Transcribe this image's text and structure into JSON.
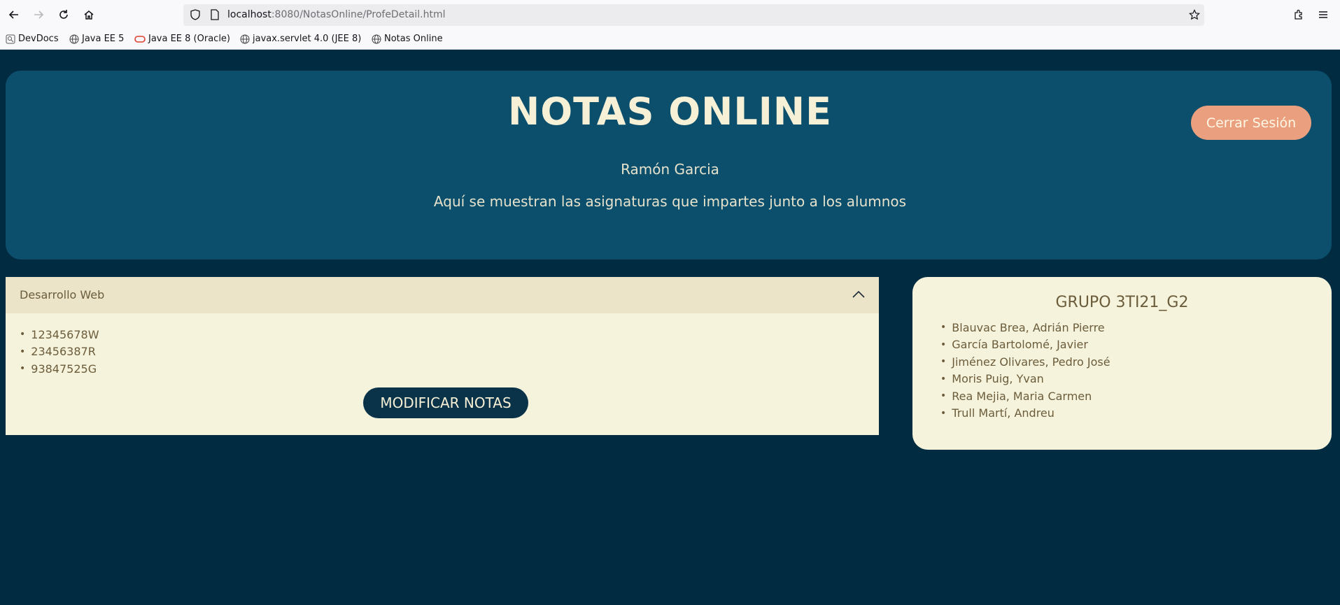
{
  "browser": {
    "url_host": "localhost",
    "url_rest": ":8080/NotasOnline/ProfeDetail.html",
    "bookmarks": [
      {
        "label": "DevDocs",
        "icon": "devdocs-icon"
      },
      {
        "label": "Java EE 5",
        "icon": "globe-icon"
      },
      {
        "label": "Java EE 8 (Oracle)",
        "icon": "oracle-icon"
      },
      {
        "label": "javax.servlet 4.0 (JEE 8)",
        "icon": "globe-icon"
      },
      {
        "label": "Notas Online",
        "icon": "globe-icon"
      }
    ]
  },
  "header": {
    "title": "NOTAS ONLINE",
    "user_name": "Ramón Garcia",
    "description": "Aquí se muestran las asignaturas que impartes junto a los alumnos",
    "logout_label": "Cerrar Sesión"
  },
  "subject": {
    "name": "Desarrollo Web",
    "students": [
      "12345678W",
      "23456387R",
      "93847525G"
    ],
    "modify_label": "MODIFICAR NOTAS"
  },
  "group": {
    "title": "GRUPO 3TI21_G2",
    "members": [
      "Blauvac Brea, Adrián Pierre",
      "García Bartolomé, Javier",
      "Jiménez Olivares, Pedro José",
      "Moris Puig, Yvan",
      "Rea Mejia, Maria Carmen",
      "Trull Martí, Andreu"
    ]
  },
  "colors": {
    "page_bg": "#002b40",
    "hero_bg": "#0c4f6c",
    "card_bg": "#f6f3dc",
    "accent": "#eaa07e",
    "button_dark": "#0a3248"
  }
}
